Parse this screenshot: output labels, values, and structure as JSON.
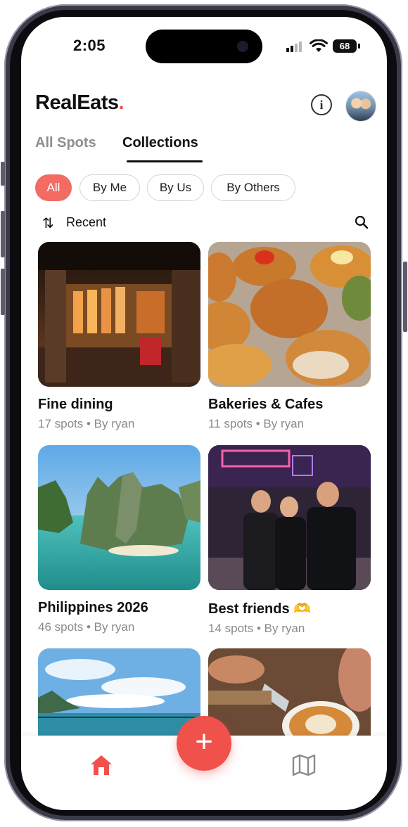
{
  "status_bar": {
    "time": "2:05",
    "battery": "68"
  },
  "header": {
    "logo_text": "RealEats",
    "logo_dot": ".",
    "info_glyph": "i"
  },
  "tabs": [
    {
      "label": "All Spots",
      "active": false
    },
    {
      "label": "Collections",
      "active": true
    }
  ],
  "filters": [
    {
      "label": "All",
      "active": true
    },
    {
      "label": "By Me",
      "active": false
    },
    {
      "label": "By Us",
      "active": false
    },
    {
      "label": "By Others",
      "active": false
    }
  ],
  "sort": {
    "label": "Recent",
    "icon": "sort-arrows-icon"
  },
  "collections": [
    {
      "title": "Fine dining",
      "subtitle": "17 spots • By ryan",
      "image": "restaurant-interior"
    },
    {
      "title": "Bakeries & Cafes",
      "subtitle": "11 spots • By ryan",
      "image": "pastries"
    },
    {
      "title": "Philippines 2026",
      "subtitle": "46 spots • By ryan",
      "image": "tropical-lagoon"
    },
    {
      "title": "Best friends 🫶",
      "subtitle": "14 spots • By ryan",
      "image": "friends-night-street"
    },
    {
      "title": "",
      "subtitle": "",
      "image": "beach-sky"
    },
    {
      "title": "",
      "subtitle": "",
      "image": "latte-art"
    }
  ],
  "bottom_nav": {
    "home_icon": "home-icon",
    "map_icon": "map-icon",
    "add_icon": "plus-icon"
  },
  "colors": {
    "accent": "#f0514a",
    "chip_active": "#f36b63",
    "text": "#111111",
    "muted": "#8a8a8a"
  }
}
